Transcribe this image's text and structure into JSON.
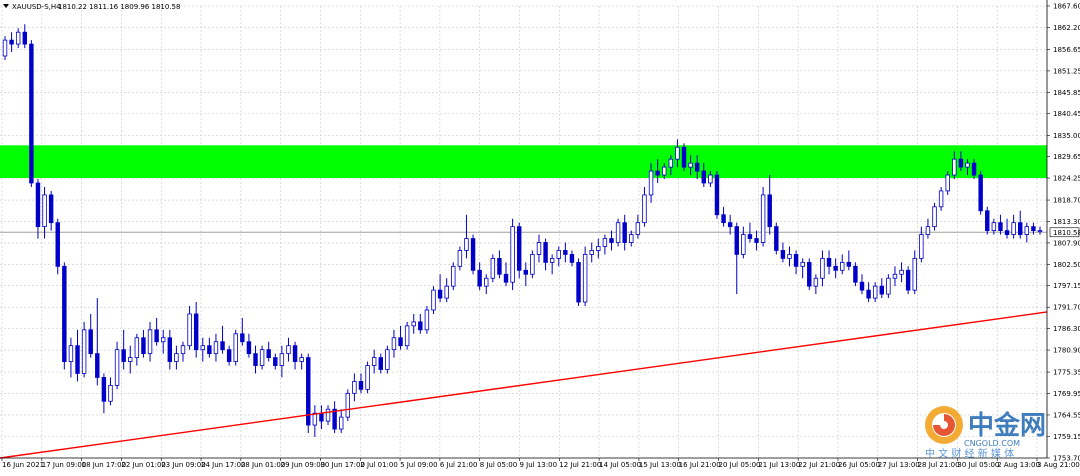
{
  "header": {
    "symbol": "XAUUSD-S,H4",
    "ohlc": "1810.22 1811.16 1809.96 1810.58"
  },
  "watermark": {
    "brand": "中金网",
    "site": "CNGOLD.COM",
    "tagline": "中 文 财 经 新 媒 体"
  },
  "colors": {
    "background": "#ffffff",
    "grid": "#c8c8c8",
    "candle": "#0000c8",
    "zone": "#00ff00",
    "trendline": "#ff0000",
    "price_tag_bg": "#ffffff"
  },
  "chart_data": {
    "type": "candlestick",
    "symbol": "XAUUSD-S",
    "timeframe": "H4",
    "y_ticks": [
      "1867.60",
      "1862.20",
      "1856.65",
      "1851.25",
      "1845.85",
      "1840.45",
      "1835.00",
      "1829.65",
      "1824.25",
      "1818.70",
      "1813.30",
      "1807.90",
      "1802.50",
      "1797.15",
      "1791.70",
      "1786.30",
      "1780.90",
      "1775.35",
      "1769.95",
      "1764.55",
      "1759.15",
      "1753.70"
    ],
    "x_ticks": [
      "16 Jun 2021",
      "17 Jun 09:00",
      "18 Jun 17:00",
      "22 Jun 01:00",
      "23 Jun 09:00",
      "24 Jun 17:00",
      "28 Jun 01:00",
      "29 Jun 09:00",
      "30 Jun 17:00",
      "2 Jul 01:00",
      "5 Jul 09:00",
      "6 Jul 21:00",
      "8 Jul 05:00",
      "9 Jul 13:00",
      "12 Jul 21:00",
      "14 Jul 05:00",
      "15 Jul 13:00",
      "16 Jul 21:00",
      "20 Jul 05:00",
      "21 Jul 13:00",
      "22 Jul 21:00",
      "26 Jul 05:00",
      "27 Jul 13:00",
      "28 Jul 21:00",
      "30 Jul 05:00",
      "2 Aug 13:00",
      "3 Aug 21:00"
    ],
    "ylim": [
      1753.7,
      1867.6
    ],
    "current_price": "1810.58",
    "resistance_zone": [
      1824.25,
      1832.5
    ],
    "trendline": {
      "start": 1753.7,
      "end": 1790.5
    },
    "candles": [
      [
        1855,
        1860,
        1854,
        1859
      ],
      [
        1859,
        1861,
        1856,
        1858
      ],
      [
        1858,
        1862,
        1857,
        1861
      ],
      [
        1861,
        1863,
        1857,
        1858
      ],
      [
        1858,
        1859,
        1822,
        1823
      ],
      [
        1823,
        1824,
        1809,
        1812
      ],
      [
        1812,
        1822,
        1809,
        1820
      ],
      [
        1820,
        1821,
        1811,
        1813
      ],
      [
        1813,
        1814,
        1800,
        1802
      ],
      [
        1802,
        1803,
        1776,
        1778
      ],
      [
        1778,
        1784,
        1774,
        1782
      ],
      [
        1782,
        1786,
        1773,
        1775
      ],
      [
        1775,
        1788,
        1774,
        1786
      ],
      [
        1786,
        1790,
        1779,
        1780
      ],
      [
        1780,
        1794,
        1772,
        1774
      ],
      [
        1774,
        1775,
        1765,
        1768
      ],
      [
        1768,
        1774,
        1767,
        1772
      ],
      [
        1772,
        1783,
        1771,
        1781
      ],
      [
        1781,
        1786,
        1776,
        1778
      ],
      [
        1778,
        1782,
        1775,
        1779
      ],
      [
        1779,
        1785,
        1777,
        1784
      ],
      [
        1784,
        1786,
        1779,
        1780
      ],
      [
        1780,
        1788,
        1778,
        1786
      ],
      [
        1786,
        1789,
        1782,
        1783
      ],
      [
        1783,
        1786,
        1780,
        1784
      ],
      [
        1784,
        1786,
        1776,
        1778
      ],
      [
        1778,
        1782,
        1776,
        1780
      ],
      [
        1780,
        1783,
        1778,
        1782
      ],
      [
        1782,
        1792,
        1781,
        1790
      ],
      [
        1790,
        1793,
        1779,
        1781
      ],
      [
        1781,
        1784,
        1778,
        1782
      ],
      [
        1782,
        1784,
        1779,
        1780
      ],
      [
        1780,
        1785,
        1778,
        1783
      ],
      [
        1783,
        1787,
        1780,
        1781
      ],
      [
        1781,
        1782,
        1777,
        1778
      ],
      [
        1778,
        1786,
        1777,
        1785
      ],
      [
        1785,
        1789,
        1782,
        1783
      ],
      [
        1783,
        1785,
        1779,
        1780
      ],
      [
        1780,
        1782,
        1775,
        1777
      ],
      [
        1777,
        1782,
        1776,
        1781
      ],
      [
        1781,
        1783,
        1778,
        1779
      ],
      [
        1779,
        1780,
        1776,
        1777
      ],
      [
        1777,
        1782,
        1774,
        1780
      ],
      [
        1780,
        1784,
        1778,
        1782
      ],
      [
        1782,
        1783,
        1776,
        1778
      ],
      [
        1778,
        1780,
        1776,
        1779
      ],
      [
        1779,
        1780,
        1760,
        1762
      ],
      [
        1762,
        1767,
        1759,
        1765
      ],
      [
        1765,
        1767,
        1761,
        1763
      ],
      [
        1763,
        1767,
        1762,
        1766
      ],
      [
        1766,
        1768,
        1760,
        1761
      ],
      [
        1761,
        1766,
        1760,
        1764
      ],
      [
        1764,
        1771,
        1763,
        1770
      ],
      [
        1770,
        1775,
        1768,
        1773
      ],
      [
        1773,
        1775,
        1770,
        1771
      ],
      [
        1771,
        1778,
        1770,
        1777
      ],
      [
        1777,
        1781,
        1775,
        1779
      ],
      [
        1779,
        1780,
        1775,
        1776
      ],
      [
        1776,
        1782,
        1775,
        1781
      ],
      [
        1781,
        1786,
        1779,
        1784
      ],
      [
        1784,
        1787,
        1781,
        1782
      ],
      [
        1782,
        1788,
        1781,
        1787
      ],
      [
        1787,
        1790,
        1785,
        1788
      ],
      [
        1788,
        1790,
        1785,
        1786
      ],
      [
        1786,
        1792,
        1785,
        1791
      ],
      [
        1791,
        1797,
        1790,
        1796
      ],
      [
        1796,
        1800,
        1793,
        1794
      ],
      [
        1794,
        1799,
        1793,
        1797
      ],
      [
        1797,
        1803,
        1796,
        1802
      ],
      [
        1802,
        1807,
        1801,
        1806
      ],
      [
        1806,
        1815,
        1804,
        1809
      ],
      [
        1809,
        1810,
        1800,
        1801
      ],
      [
        1801,
        1803,
        1796,
        1797
      ],
      [
        1797,
        1800,
        1795,
        1799
      ],
      [
        1799,
        1805,
        1798,
        1804
      ],
      [
        1804,
        1806,
        1799,
        1800
      ],
      [
        1800,
        1803,
        1797,
        1798
      ],
      [
        1798,
        1814,
        1796,
        1812
      ],
      [
        1812,
        1813,
        1799,
        1801
      ],
      [
        1801,
        1803,
        1797,
        1800
      ],
      [
        1800,
        1806,
        1799,
        1805
      ],
      [
        1805,
        1810,
        1803,
        1808
      ],
      [
        1808,
        1809,
        1801,
        1803
      ],
      [
        1803,
        1805,
        1800,
        1804
      ],
      [
        1804,
        1807,
        1802,
        1806
      ],
      [
        1806,
        1808,
        1803,
        1805
      ],
      [
        1805,
        1806,
        1802,
        1803
      ],
      [
        1803,
        1804,
        1792,
        1793
      ],
      [
        1793,
        1807,
        1792,
        1805
      ],
      [
        1805,
        1808,
        1803,
        1806
      ],
      [
        1806,
        1809,
        1804,
        1807
      ],
      [
        1807,
        1810,
        1805,
        1809
      ],
      [
        1809,
        1811,
        1806,
        1808
      ],
      [
        1808,
        1814,
        1807,
        1813
      ],
      [
        1813,
        1815,
        1806,
        1808
      ],
      [
        1808,
        1811,
        1807,
        1810
      ],
      [
        1810,
        1815,
        1809,
        1813
      ],
      [
        1813,
        1822,
        1812,
        1820
      ],
      [
        1820,
        1828,
        1818,
        1826
      ],
      [
        1826,
        1829,
        1823,
        1825
      ],
      [
        1825,
        1828,
        1824,
        1827
      ],
      [
        1827,
        1830,
        1825,
        1829
      ],
      [
        1829,
        1834,
        1827,
        1832
      ],
      [
        1832,
        1833,
        1826,
        1827
      ],
      [
        1827,
        1830,
        1825,
        1828
      ],
      [
        1828,
        1830,
        1824,
        1826
      ],
      [
        1826,
        1828,
        1822,
        1823
      ],
      [
        1823,
        1826,
        1822,
        1825
      ],
      [
        1825,
        1826,
        1814,
        1815
      ],
      [
        1815,
        1817,
        1812,
        1813
      ],
      [
        1813,
        1815,
        1810,
        1812
      ],
      [
        1812,
        1813,
        1795,
        1805
      ],
      [
        1805,
        1812,
        1804,
        1810
      ],
      [
        1810,
        1813,
        1808,
        1809
      ],
      [
        1809,
        1811,
        1806,
        1808
      ],
      [
        1808,
        1822,
        1807,
        1820
      ],
      [
        1820,
        1825,
        1810,
        1812
      ],
      [
        1812,
        1813,
        1805,
        1806
      ],
      [
        1806,
        1808,
        1803,
        1804
      ],
      [
        1804,
        1807,
        1802,
        1805
      ],
      [
        1805,
        1806,
        1800,
        1802
      ],
      [
        1802,
        1804,
        1799,
        1803
      ],
      [
        1803,
        1804,
        1796,
        1797
      ],
      [
        1797,
        1800,
        1795,
        1799
      ],
      [
        1799,
        1806,
        1797,
        1804
      ],
      [
        1804,
        1806,
        1800,
        1802
      ],
      [
        1802,
        1804,
        1799,
        1801
      ],
      [
        1801,
        1805,
        1800,
        1803
      ],
      [
        1803,
        1806,
        1801,
        1802
      ],
      [
        1802,
        1803,
        1797,
        1798
      ],
      [
        1798,
        1800,
        1795,
        1796
      ],
      [
        1796,
        1798,
        1793,
        1794
      ],
      [
        1794,
        1798,
        1793,
        1797
      ],
      [
        1797,
        1799,
        1794,
        1795
      ],
      [
        1795,
        1800,
        1794,
        1799
      ],
      [
        1799,
        1802,
        1797,
        1800
      ],
      [
        1800,
        1803,
        1798,
        1801
      ],
      [
        1801,
        1802,
        1795,
        1796
      ],
      [
        1796,
        1806,
        1795,
        1804
      ],
      [
        1804,
        1812,
        1803,
        1810
      ],
      [
        1810,
        1814,
        1809,
        1812
      ],
      [
        1812,
        1818,
        1811,
        1817
      ],
      [
        1817,
        1822,
        1816,
        1821
      ],
      [
        1821,
        1826,
        1820,
        1825
      ],
      [
        1825,
        1831,
        1824,
        1829
      ],
      [
        1829,
        1831,
        1826,
        1827
      ],
      [
        1827,
        1829,
        1825,
        1828
      ],
      [
        1828,
        1829,
        1824,
        1825
      ],
      [
        1825,
        1826,
        1815,
        1816
      ],
      [
        1816,
        1817,
        1810,
        1811
      ],
      [
        1811,
        1814,
        1810,
        1813
      ],
      [
        1813,
        1815,
        1810,
        1811
      ],
      [
        1811,
        1814,
        1809,
        1810
      ],
      [
        1810,
        1815,
        1809,
        1813
      ],
      [
        1813,
        1816,
        1809,
        1810
      ],
      [
        1810,
        1813,
        1808,
        1812
      ],
      [
        1812,
        1813,
        1810,
        1811
      ],
      [
        1811,
        1812,
        1810,
        1811
      ]
    ]
  }
}
